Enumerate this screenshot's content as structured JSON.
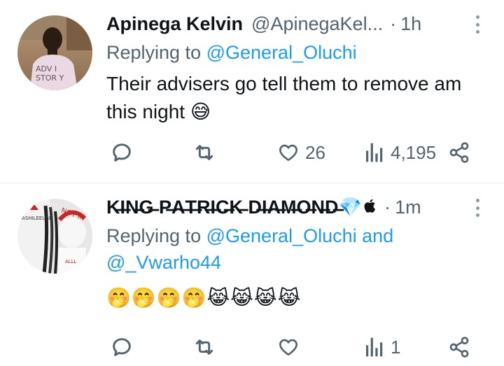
{
  "tweets": [
    {
      "display_name": "Apinega Kelvin",
      "handle": "@ApinegaKel...",
      "time": "1h",
      "replying_prefix": "Replying to",
      "replying_to": "@General_Oluchi",
      "replying_and": "",
      "replying_to_2": "",
      "text": "Their advisers go tell them to remove am this night",
      "text_emoji": "😅",
      "emoji_line": "",
      "stats": {
        "replies": "",
        "retweets": "",
        "likes": "26",
        "views": "4,195"
      }
    },
    {
      "display_name": "K̶I̶N̶G̶ P̶A̶T̶R̶I̶C̶K̶ D̶I̶A̶M̶O̶N̶D̶",
      "name_badges": "💎",
      "apple_badge": "",
      "handle": "",
      "time": "1m",
      "replying_prefix": "Replying to",
      "replying_to": "@General_Oluchi",
      "replying_and": "and",
      "replying_to_2": "@_Vwarho44",
      "text": "",
      "text_emoji": "",
      "emoji_line": "🤭🤭🤭🤭😹😹😹😹",
      "stats": {
        "replies": "",
        "retweets": "",
        "likes": "",
        "views": "1"
      }
    }
  ],
  "separator": "·",
  "colors": {
    "link": "#1d9bf0",
    "muted": "#536471",
    "text": "#0f1419",
    "divider": "#e4e7ea"
  },
  "icons": [
    "reply-icon",
    "retweet-icon",
    "heart-icon",
    "views-icon",
    "share-icon",
    "more-icon"
  ]
}
